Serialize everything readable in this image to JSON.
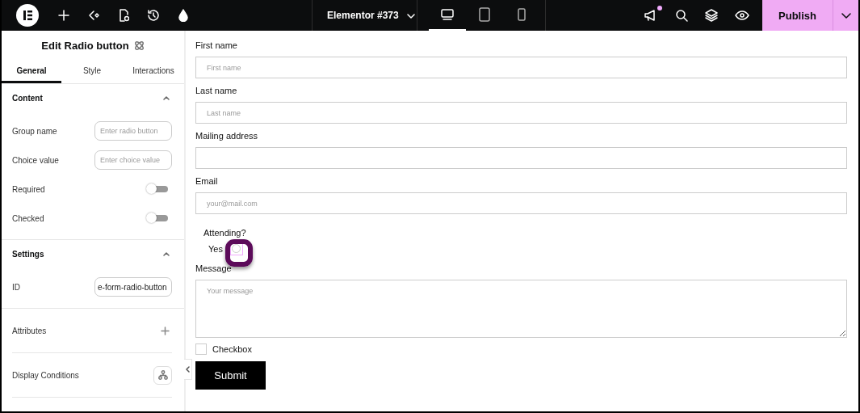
{
  "top_bar": {
    "document_title": "Elementor #373",
    "devices": [
      {
        "selected": true
      },
      {
        "selected": false
      },
      {
        "selected": false
      }
    ],
    "notification": true,
    "publish_label": "Publish"
  },
  "panel": {
    "title": "Edit Radio button",
    "tabs": [
      {
        "label": "General",
        "selected": true
      },
      {
        "label": "Style",
        "selected": false
      },
      {
        "label": "Interactions",
        "selected": false
      }
    ],
    "sections": [
      {
        "title": "Content",
        "expanded": true,
        "rows": [
          {
            "kind": "field",
            "label": "Group name",
            "placeholder": "Enter radio button"
          },
          {
            "kind": "field",
            "label": "Choice value",
            "placeholder": "Enter choice value"
          },
          {
            "kind": "toggle",
            "label": "Required",
            "on": false
          },
          {
            "kind": "toggle",
            "label": "Checked",
            "on": false
          }
        ]
      },
      {
        "title": "Settings",
        "expanded": true,
        "rows": [
          {
            "kind": "field",
            "label": "ID",
            "value": "e-form-radio-button"
          }
        ]
      }
    ],
    "extras": [
      {
        "kind": "plus",
        "label": "Attributes"
      },
      {
        "kind": "conditions",
        "label": "Display Conditions"
      }
    ]
  },
  "form": {
    "fields": [
      {
        "kind": "text",
        "label": "First name",
        "placeholder": "First name"
      },
      {
        "kind": "text",
        "label": "Last name",
        "placeholder": "Last name"
      },
      {
        "kind": "text",
        "label": "Mailing address"
      },
      {
        "kind": "text",
        "label": "Email",
        "placeholder": "your@mail.com"
      },
      {
        "kind": "radio",
        "label": "Attending?",
        "options": [
          {
            "label": "Yes",
            "selected": false,
            "highlighted": true
          }
        ]
      },
      {
        "kind": "textarea",
        "label": "Message",
        "placeholder": "Your message"
      },
      {
        "kind": "checkbox",
        "label": "Checkbox",
        "checked": false
      }
    ],
    "submit_label": "Submit"
  }
}
